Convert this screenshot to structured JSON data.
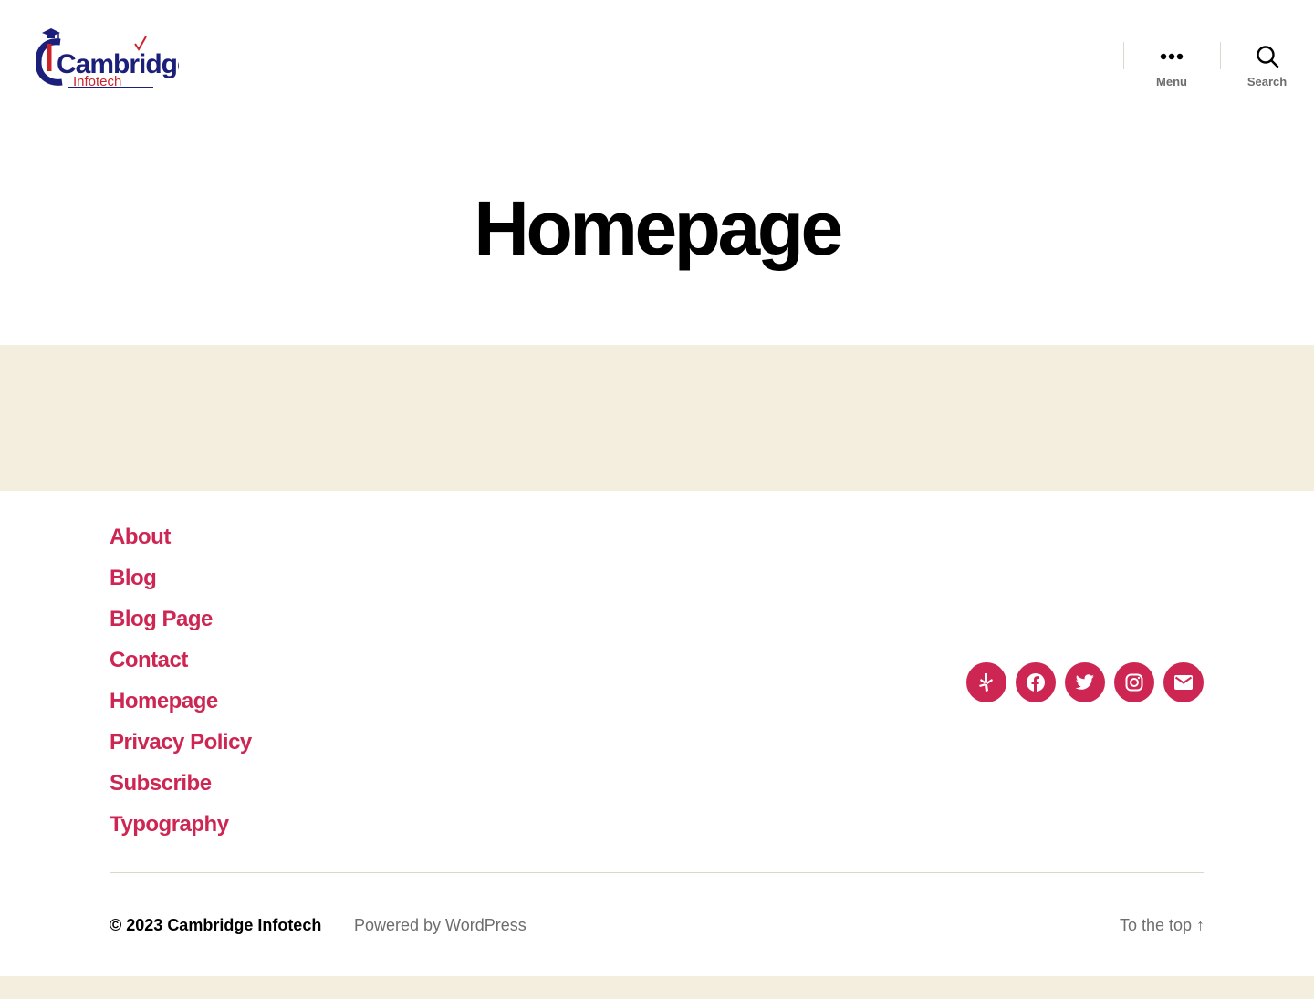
{
  "header": {
    "logo": {
      "line1": "Cambridge",
      "line2": "Infotech",
      "colors": {
        "navy": "#1b1f7a",
        "red": "#cc2229"
      }
    },
    "menu_label": "Menu",
    "search_label": "Search"
  },
  "page": {
    "title": "Homepage"
  },
  "footer": {
    "menu": [
      {
        "label": "About"
      },
      {
        "label": "Blog"
      },
      {
        "label": "Blog Page"
      },
      {
        "label": "Contact"
      },
      {
        "label": "Homepage"
      },
      {
        "label": "Privacy Policy"
      },
      {
        "label": "Subscribe"
      },
      {
        "label": "Typography"
      }
    ],
    "social_icons": [
      "yelp-icon",
      "facebook-icon",
      "twitter-icon",
      "instagram-icon",
      "email-icon"
    ],
    "copyright_prefix": "© 2023 ",
    "site_name": "Cambridge Infotech",
    "powered_by": "Powered by WordPress",
    "to_top": "To the top ↑"
  },
  "colors": {
    "accent": "#cd2653",
    "beige": "#f4eedf",
    "muted": "#6d6d6d",
    "border": "#dcd7ca"
  }
}
